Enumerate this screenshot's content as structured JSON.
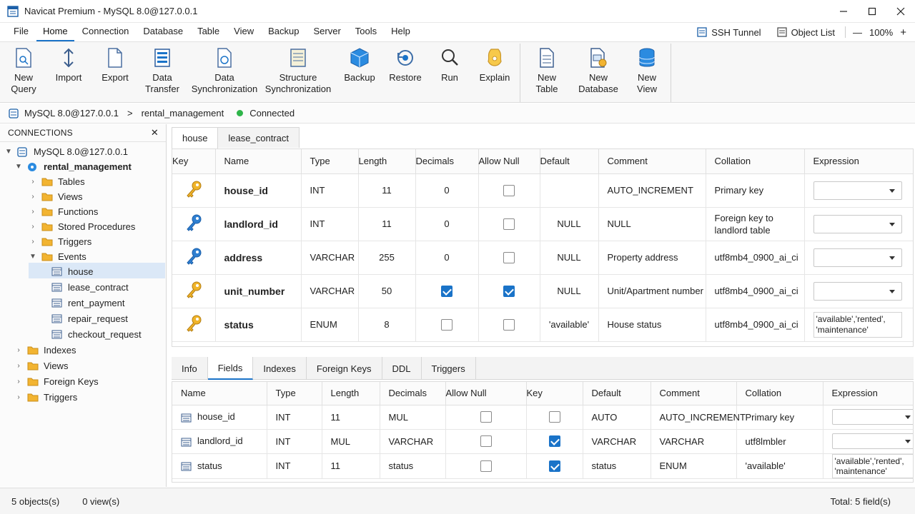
{
  "window": {
    "title": "Navicat Premium - MySQL 8.0@127.0.0.1"
  },
  "menu": {
    "items": [
      "File",
      "Home",
      "Connection",
      "Database",
      "Table",
      "View",
      "Backup",
      "Server",
      "Tools",
      "Help"
    ],
    "active": "Home",
    "ssh_tunnel": "SSH Tunnel",
    "object_list": "Object List",
    "zoom_minus": "—",
    "zoom": "100%",
    "zoom_plus": "+"
  },
  "ribbon": {
    "buttons": [
      {
        "l1": "New",
        "l2": "Query",
        "icon": "new-query-icon"
      },
      {
        "l1": "Import",
        "l2": "",
        "icon": "import-icon"
      },
      {
        "l1": "Export",
        "l2": "",
        "icon": "export-icon"
      },
      {
        "l1": "Data",
        "l2": "Transfer",
        "icon": "data-transfer-icon"
      },
      {
        "l1": "Data",
        "l2": "Synchronization",
        "icon": "data-sync-icon"
      },
      {
        "l1": "Structure",
        "l2": "Synchronization",
        "icon": "structure-sync-icon"
      },
      {
        "l1": "Backup",
        "l2": "",
        "icon": "backup-icon"
      },
      {
        "l1": "Restore",
        "l2": "",
        "icon": "restore-icon"
      },
      {
        "l1": "Run",
        "l2": "",
        "icon": "run-icon"
      },
      {
        "l1": "Explain",
        "l2": "",
        "icon": "explain-icon"
      },
      {
        "l1": "New Table",
        "l2": "",
        "icon": "new-table-icon"
      },
      {
        "l1": "New",
        "l2": "Database",
        "icon": "new-database-icon"
      },
      {
        "l1": "New",
        "l2": "View",
        "icon": "new-view-icon"
      }
    ]
  },
  "path": {
    "connection": "MySQL 8.0@127.0.0.1",
    "separator": ">",
    "database": "rental_management",
    "status": "Connected"
  },
  "colors": {
    "accent": "#1a73c8",
    "connected": "#2fb54a",
    "folder": "#f2b431",
    "key": "#f0b429",
    "foreign_key": "#2f7fd1"
  },
  "sidebar": {
    "header": "CONNECTIONS",
    "close": "✕",
    "nodes": {
      "connection": "MySQL 8.0@127.0.0.1",
      "database": "rental_management",
      "tables": "Tables",
      "views": "Views",
      "functions": "Functions",
      "procedures": "Stored Procedures",
      "triggers": "Triggers",
      "events": "Events",
      "t1": "house",
      "t2": "lease_contract",
      "t3": "rent_payment",
      "t4": "repair_request",
      "t5": "checkout_request",
      "indexes2": "Indexes",
      "views2": "Views",
      "fkeys2": "Foreign Keys",
      "triggers2": "Triggers"
    }
  },
  "tabs": {
    "t1": "house",
    "t2": "lease_contract"
  },
  "grid1": {
    "headers": {
      "key": "Key",
      "name": "Name",
      "type": "Type",
      "length": "Length",
      "decimals": "Decimals",
      "allow_null": "Allow Null",
      "default": "Default",
      "comment": "Comment",
      "collation": "Collation",
      "expression": "Expression"
    },
    "rows": [
      {
        "key": "primary",
        "name": "house_id",
        "type": "INT",
        "length": "11",
        "decimals": "0",
        "decimals_check": false,
        "null": false,
        "default": "",
        "comment": "AUTO_INCREMENT",
        "collation": "Primary key",
        "expr": ""
      },
      {
        "key": "foreign",
        "name": "landlord_id",
        "type": "INT",
        "length": "11",
        "decimals": "0",
        "decimals_check": false,
        "null": false,
        "default": "NULL",
        "comment": "NULL",
        "collation": "Foreign key to landlord table",
        "expr": ""
      },
      {
        "key": "foreign",
        "name": "address",
        "type": "VARCHAR",
        "length": "255",
        "decimals": "0",
        "decimals_check": false,
        "null": false,
        "default": "NULL",
        "comment": "Property address",
        "collation": "utf8mb4_0900_ai_ci",
        "expr": ""
      },
      {
        "key": "primary",
        "name": "unit_number",
        "type": "VARCHAR",
        "length": "50",
        "decimals": "",
        "decimals_check": true,
        "null": true,
        "default": "NULL",
        "comment": "Unit/Apartment number",
        "collation": "utf8mb4_0900_ai_ci",
        "expr": ""
      },
      {
        "key": "primary",
        "name": "status",
        "type": "ENUM",
        "length": "8",
        "decimals": "",
        "decimals_check": false,
        "null": false,
        "default": "'available'",
        "comment": "House status",
        "collation": "utf8mb4_0900_ai_ci",
        "expr": "'available','rented', 'maintenance'"
      }
    ]
  },
  "btabs": {
    "info": "Info",
    "fields": "Fields",
    "indexes": "Indexes",
    "fkeys": "Foreign Keys",
    "ddl": "DDL",
    "triggers": "Triggers"
  },
  "grid2": {
    "headers": {
      "name": "Name",
      "type": "Type",
      "length": "Length",
      "decimals": "Decimals",
      "allow_null": "Allow Null",
      "key": "Key",
      "default": "Default",
      "comment": "Comment",
      "collation": "Collation",
      "expression": "Expression"
    },
    "rows": [
      {
        "name": "house_id",
        "type": "INT",
        "length": "11",
        "decimals": "MUL",
        "null": false,
        "key": false,
        "default": "AUTO",
        "comment": "AUTO_INCREMENT",
        "collation": "Primary key",
        "expr": ""
      },
      {
        "name": "landlord_id",
        "type": "INT",
        "length": "MUL",
        "decimals": "VARCHAR",
        "null": false,
        "key": true,
        "default": "VARCHAR",
        "comment": "VARCHAR",
        "collation": "utf8lmbler",
        "expr": ""
      },
      {
        "name": "status",
        "type": "INT",
        "length": "11",
        "decimals": "status",
        "null": false,
        "key": true,
        "default": "status",
        "comment": "ENUM",
        "collation": "'available'",
        "expr": "'available','rented', 'maintenance'"
      }
    ]
  },
  "status": {
    "objects": "5 objects(s)",
    "views": "0 view(s)",
    "total": "Total: 5 field(s)"
  }
}
